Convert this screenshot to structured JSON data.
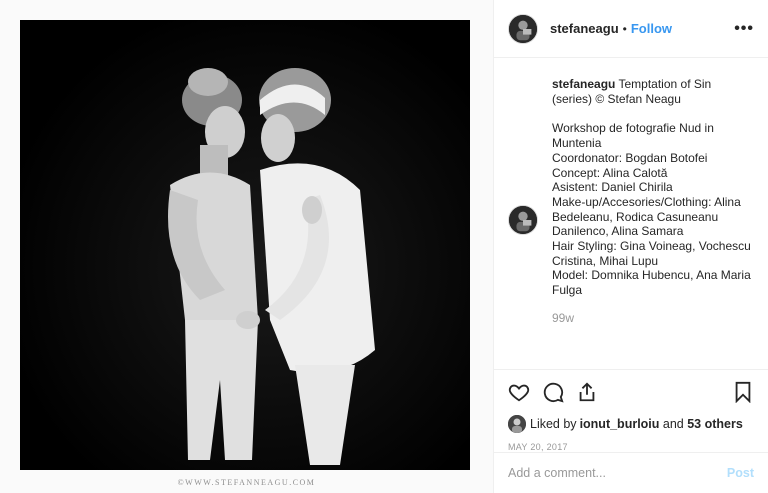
{
  "post": {
    "watermark": "©WWW.STEFANNEAGU.COM",
    "image_alt": "Black and white photograph of two women in white clothing embracing"
  },
  "header": {
    "username": "stefaneagu",
    "separator": "•",
    "follow_label": "Follow",
    "more_icon": "more-options-icon",
    "more_glyph": "•••"
  },
  "caption": {
    "username": "stefaneagu",
    "title": "Temptation of Sin (series) © Stefan Neagu",
    "lines": [
      "Workshop de fotografie Nud in Muntenia",
      "Coordonator: Bogdan Botofei",
      "Concept: Alina Calotă",
      "Asistent: Daniel Chirila",
      "Make-up/Accesories/Clothing: Alina Bedeleanu, Rodica Casuneanu Danilenco, Alina Samara",
      "Hair Styling: Gina Voineag, Vochescu Cristina, Mihai Lupu",
      "Model: Domnika Hubencu, Ana Maria Fulga"
    ],
    "time_ago": "99w"
  },
  "actions": {
    "icons": [
      "heart-icon",
      "comment-icon",
      "share-icon",
      "bookmark-icon"
    ],
    "liked_by_prefix": "Liked by ",
    "liked_by_user": "ionut_burloiu",
    "liked_by_and": " and ",
    "liked_by_others": "53 others",
    "date": "MAY 20, 2017"
  },
  "comment": {
    "placeholder": "Add a comment...",
    "post_label": "Post"
  },
  "colors": {
    "link_blue": "#3897f0",
    "post_disabled": "#b2dffc",
    "muted": "#999999",
    "border": "#efefef"
  }
}
